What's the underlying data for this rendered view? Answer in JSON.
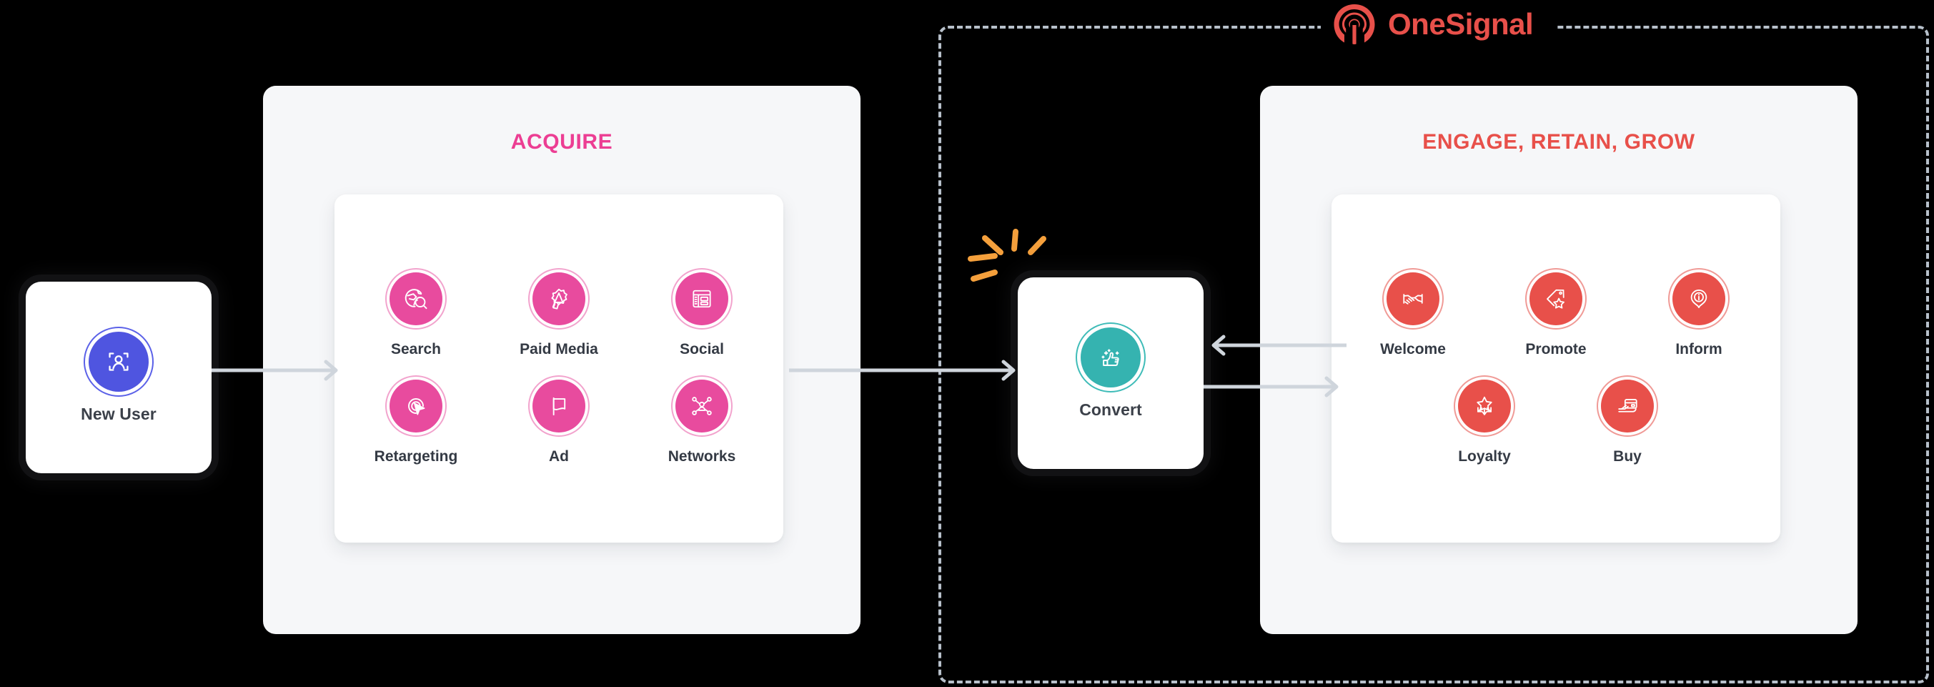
{
  "brand": {
    "logo_word_1": "One",
    "logo_word_2": "Signal",
    "logo_icon": "onesignal-broadcast-icon",
    "pink": "#e84b9e",
    "red": "#e8504a",
    "teal": "#35b3b0",
    "indigo": "#4f55e0",
    "orange": "#f5a03c",
    "panel_bg": "#f6f7f9",
    "dashed_border": "#b7c0ca",
    "arrow": "#cfd5dc"
  },
  "entry_node": {
    "label": "New User",
    "icon": "user-scan-icon",
    "accent": "#4f55e0"
  },
  "convert_node": {
    "label": "Convert",
    "icon": "thumbs-up-sparkle-icon",
    "accent": "#35b3b0",
    "sparkle": "sparkle-rays-icon"
  },
  "acquire_panel": {
    "title": "ACQUIRE",
    "accent": "#ec3e93",
    "rows": [
      [
        {
          "label": "Search",
          "icon": "globe-search-icon"
        },
        {
          "label": "Paid Media",
          "icon": "megaphone-burst-icon"
        },
        {
          "label": "Social",
          "icon": "social-layout-icon"
        }
      ],
      [
        {
          "label": "Retargeting",
          "icon": "target-cursor-icon"
        },
        {
          "label": "Ad",
          "icon": "flag-icon"
        },
        {
          "label": "Networks",
          "icon": "network-nodes-icon"
        }
      ]
    ]
  },
  "engage_panel": {
    "title": "ENGAGE, RETAIN, GROW",
    "accent": "#e8504a",
    "rows": [
      [
        {
          "label": "Welcome",
          "icon": "handshake-icon"
        },
        {
          "label": "Promote",
          "icon": "tag-star-icon"
        },
        {
          "label": "Inform",
          "icon": "info-pin-icon"
        }
      ],
      [
        {
          "label": "Loyalty",
          "icon": "star-burst-icon"
        },
        {
          "label": "Buy",
          "icon": "hand-card-icon"
        }
      ]
    ]
  },
  "connectors": [
    {
      "name": "new-user-to-acquire",
      "direction": "right"
    },
    {
      "name": "acquire-to-convert",
      "direction": "right"
    },
    {
      "name": "engage-to-convert",
      "direction": "left"
    },
    {
      "name": "convert-to-engage",
      "direction": "right"
    }
  ]
}
